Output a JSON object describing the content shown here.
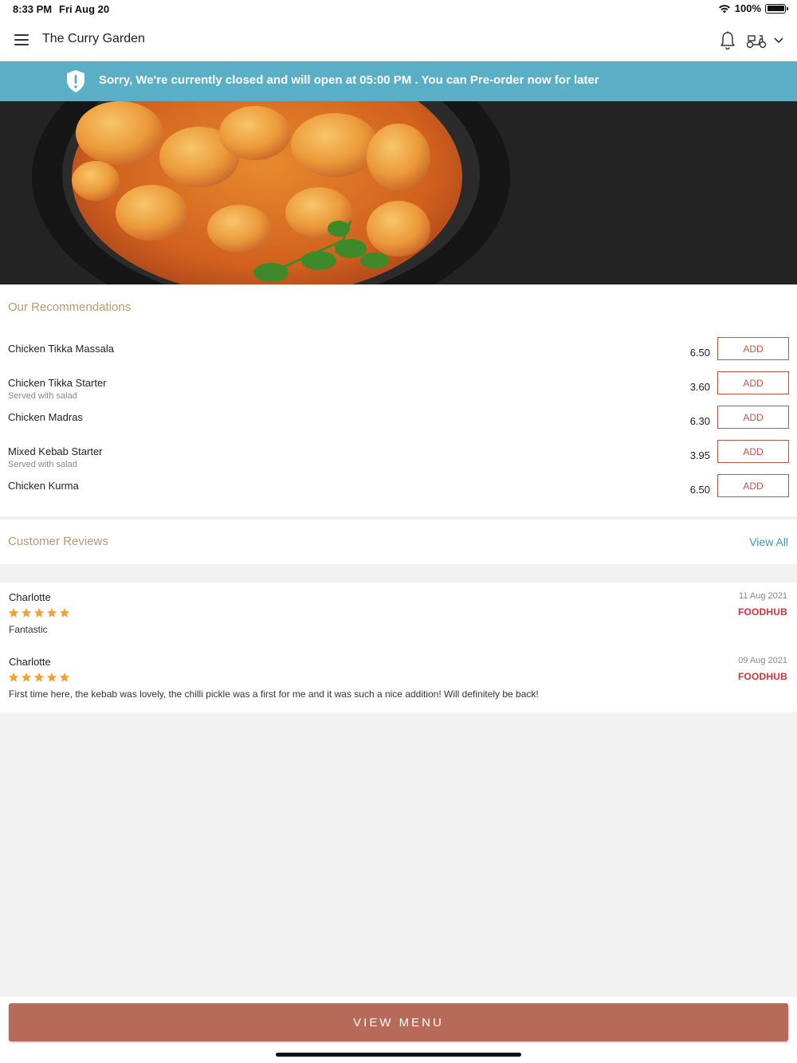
{
  "status_bar": {
    "time": "8:33 PM",
    "date": "Fri Aug 20",
    "battery": "100%"
  },
  "header": {
    "title": "The Curry Garden",
    "menu_icon": "hamburger-menu-icon",
    "bell_icon": "bell-icon",
    "delivery_icon": "scooter-icon",
    "dropdown_icon": "chevron-down-icon"
  },
  "banner": {
    "text": "Sorry, We're currently closed and will open at 05:00 PM . You can Pre-order now for later",
    "color": "#5aaec6"
  },
  "recommendations": {
    "title": "Our Recommendations",
    "add_label": "ADD",
    "items": [
      {
        "name": "Chicken Tikka Massala",
        "description": "",
        "price": "6.50"
      },
      {
        "name": "Chicken Tikka Starter",
        "description": "Served with salad",
        "price": "3.60"
      },
      {
        "name": "Chicken Madras",
        "description": "",
        "price": "6.30"
      },
      {
        "name": "Mixed Kebab Starter",
        "description": "Served with salad",
        "price": "3.95"
      },
      {
        "name": "Chicken Kurma",
        "description": "",
        "price": "6.50"
      }
    ]
  },
  "reviews": {
    "title": "Customer Reviews",
    "view_all": "View All",
    "items": [
      {
        "name": "Charlotte",
        "rating": 5,
        "text": "Fantastic",
        "date": "11 Aug 2021",
        "source": "FOODHUB"
      },
      {
        "name": "Charlotte",
        "rating": 5,
        "text": "First time here, the kebab was lovely, the chilli pickle was a first for me and it was such a nice addition! Will definitely be back!",
        "date": "09 Aug 2021",
        "source": "FOODHUB"
      }
    ]
  },
  "footer": {
    "view_menu": "VIEW MENU",
    "button_color": "#b76a57"
  },
  "colors": {
    "accent_gold": "#b69a6f",
    "link_blue": "#3a97b6",
    "add_red": "#c1544a",
    "star_orange": "#f0a13a"
  }
}
